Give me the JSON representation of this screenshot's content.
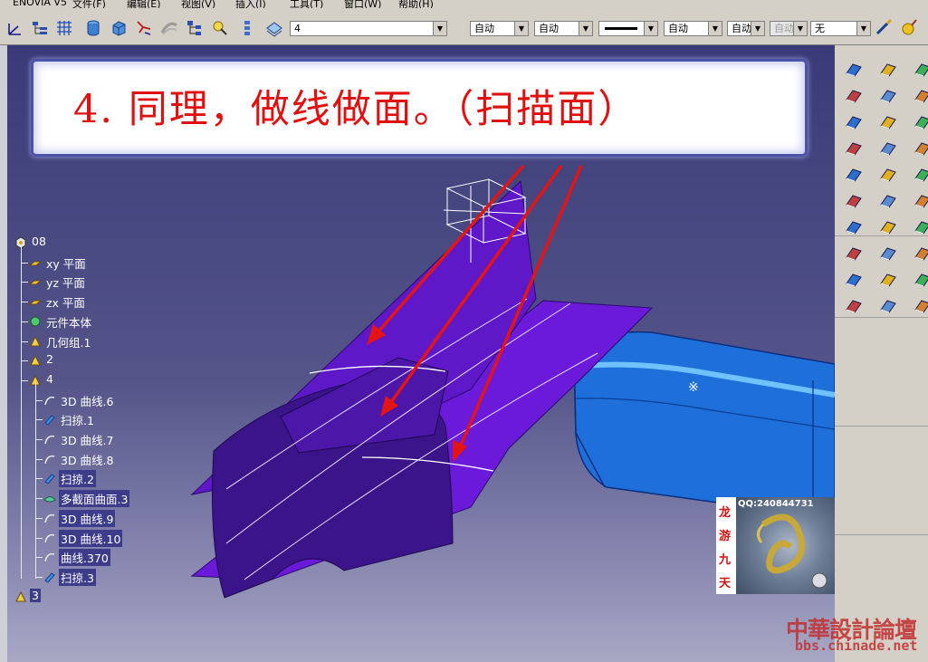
{
  "menubar": {
    "items": [
      "ENOVIA V5",
      "文件(F)",
      "编辑(E)",
      "视图(V)",
      "插入(I)",
      "工具(T)",
      "窗口(W)",
      "帮助(H)"
    ]
  },
  "toolbar": {
    "layer_combo": "4",
    "color_combo": "自动",
    "transparency_combo": "自动",
    "linetype_combo": "",
    "thickness_combo": "自动",
    "point_combo": "自动",
    "point_combo2": "自动",
    "layer_filter_combo": "无",
    "icons": [
      "axis-icon",
      "tree-icon",
      "grid-icon",
      "cylinder-view-icon",
      "cube-view-icon",
      "snap-icon",
      "render-icon",
      "hierarchy-icon",
      "stack-icon",
      "search-icon",
      "shading-icon"
    ]
  },
  "callout": {
    "text": "4. 同理，做线做面。（扫描面）",
    "text_color": "#e01010"
  },
  "tree": {
    "items": [
      {
        "label": "08",
        "icon": "part-icon",
        "highlight": false
      },
      {
        "label": "xy 平面",
        "icon": "plane-icon",
        "highlight": false
      },
      {
        "label": "yz 平面",
        "icon": "plane-icon",
        "highlight": false
      },
      {
        "label": "zx 平面",
        "icon": "plane-icon",
        "highlight": false
      },
      {
        "label": "元件本体",
        "icon": "body-icon",
        "highlight": false
      },
      {
        "label": "几何组.1",
        "icon": "geoset-icon",
        "highlight": false
      },
      {
        "label": "2",
        "icon": "geoset-icon",
        "highlight": false
      },
      {
        "label": "4",
        "icon": "geoset-icon",
        "highlight": false
      },
      {
        "label": "3D 曲线.6",
        "icon": "curve-icon",
        "highlight": false
      },
      {
        "label": "扫掠.1",
        "icon": "sweep-icon",
        "highlight": false
      },
      {
        "label": "3D 曲线.7",
        "icon": "curve-icon",
        "highlight": false
      },
      {
        "label": "3D 曲线.8",
        "icon": "curve-icon",
        "highlight": false
      },
      {
        "label": "扫掠.2",
        "icon": "sweep-icon",
        "highlight": true
      },
      {
        "label": "多截面曲面.3",
        "icon": "multisection-icon",
        "highlight": true
      },
      {
        "label": "3D 曲线.9",
        "icon": "curve-icon",
        "highlight": true
      },
      {
        "label": "3D 曲线.10",
        "icon": "curve-icon",
        "highlight": true
      },
      {
        "label": "曲线.370",
        "icon": "curve-icon",
        "highlight": true
      },
      {
        "label": "扫掠.3",
        "icon": "sweep-icon",
        "highlight": true
      },
      {
        "label": "3",
        "icon": "geoset-icon",
        "highlight": true
      }
    ]
  },
  "logo": {
    "qq": "QQ:240844731",
    "vertical_text": [
      "龙",
      "游",
      "九",
      "天"
    ]
  },
  "watermark": {
    "title": "中華設計論壇",
    "url": "bbs.chinade.net",
    "color": "#c23030"
  },
  "colors": {
    "surface_purple": "#6a1ad8",
    "surface_dark": "#3a1488",
    "part_blue": "#1e6fd9",
    "arrow_red": "#e41414"
  },
  "right_toolbar": {
    "icons": [
      "surface-icon",
      "plane-tool-icon",
      "sweep-tool-icon",
      "fill-icon",
      "extrude-icon",
      "offset-icon",
      "join-icon",
      "split-icon",
      "trim-icon",
      "boundary-icon",
      "extract-icon",
      "fillet-icon",
      "chamfer-icon",
      "translate-icon",
      "rotate-icon",
      "symmetry-icon",
      "scale-icon",
      "affinity-icon",
      "spline-icon",
      "helix-icon",
      "connect-icon",
      "corner-icon",
      "parallel-icon",
      "project-icon",
      "intersect-icon",
      "circle-icon",
      "line-icon",
      "point-icon",
      "law-icon",
      "analysis-icon"
    ]
  }
}
